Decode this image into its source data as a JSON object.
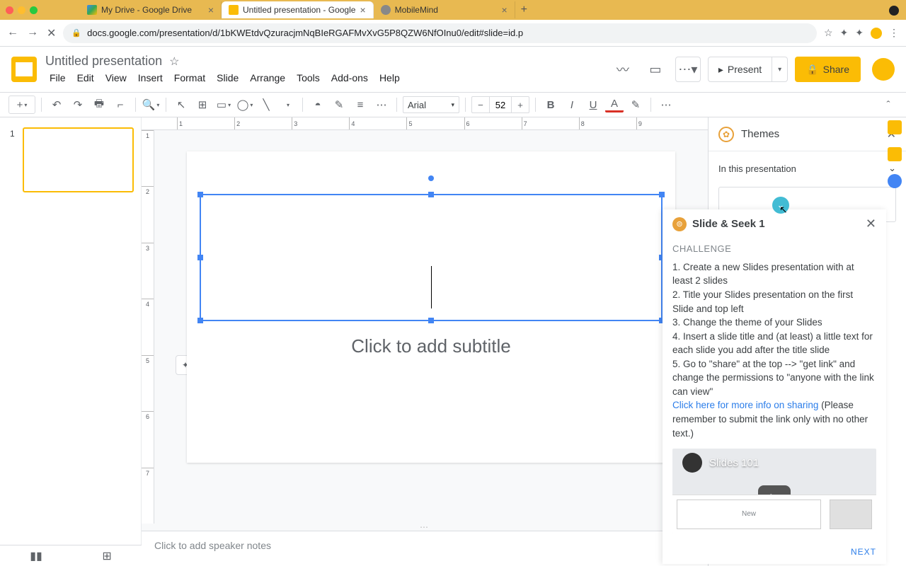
{
  "browser": {
    "tabs": [
      {
        "title": "My Drive - Google Drive",
        "active": false
      },
      {
        "title": "Untitled presentation - Google",
        "active": true
      },
      {
        "title": "MobileMind",
        "active": false
      }
    ],
    "url": "docs.google.com/presentation/d/1bKWEtdvQzuracjmNqBIeRGAFMvXvG5P8QZW6NfOInu0/edit#slide=id.p"
  },
  "doc": {
    "title": "Untitled presentation",
    "menus": [
      "File",
      "Edit",
      "View",
      "Insert",
      "Format",
      "Slide",
      "Arrange",
      "Tools",
      "Add-ons",
      "Help"
    ],
    "present": "Present",
    "share": "Share"
  },
  "toolbar": {
    "font": "Arial",
    "font_size": "52"
  },
  "canvas": {
    "subtitle_placeholder": "Click to add subtitle",
    "notes_placeholder": "Click to add speaker notes",
    "slide_number": "1"
  },
  "themes": {
    "title": "Themes",
    "dropdown": "In this presentation"
  },
  "seek": {
    "title": "Slide & Seek 1",
    "section": "CHALLENGE",
    "steps": [
      "1. Create a new Slides presentation with at least 2 slides",
      "2. Title your Slides presentation on the first Slide and top left",
      "3. Change the theme of your Slides",
      "4. Insert a slide title and (at least) a little text for each slide you add after the title slide",
      "5. Go to \"share\" at the top --> \"get link\" and change the permissions to \"anyone with the link can view\""
    ],
    "link_text": "Click here for more info on sharing",
    "link_tail": " (Please remember to submit the link only with no other text.)",
    "video_title": "Slides 101",
    "video_newslide": "New",
    "next": "NEXT"
  }
}
